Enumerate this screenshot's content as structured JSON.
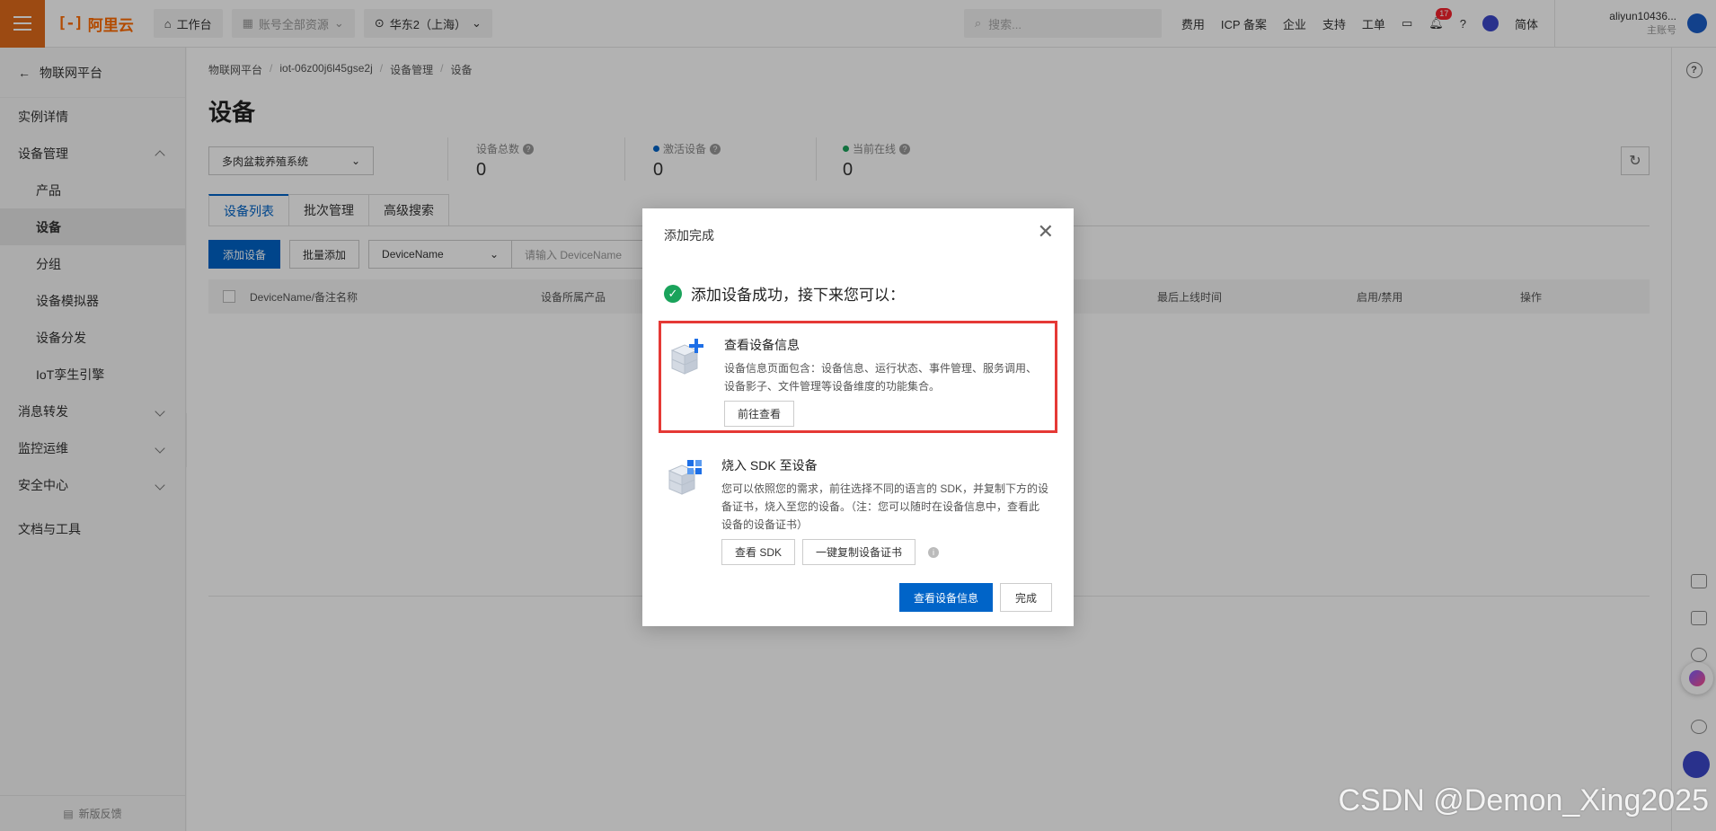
{
  "topbar": {
    "logo_text": "阿里云",
    "logo_mark": "[-]",
    "workbench": "工作台",
    "account_scope": "账号全部资源",
    "region": "华东2（上海）",
    "search_placeholder": "搜索...",
    "links": [
      "费用",
      "ICP 备案",
      "企业",
      "支持",
      "工单"
    ],
    "notification_count": "17",
    "language": "简体",
    "user_name": "aliyun10436...",
    "user_role": "主账号"
  },
  "sidebar": {
    "back_label": "物联网平台",
    "items": [
      {
        "label": "实例详情"
      },
      {
        "label": "设备管理"
      },
      {
        "label": "产品"
      },
      {
        "label": "设备"
      },
      {
        "label": "分组"
      },
      {
        "label": "设备模拟器"
      },
      {
        "label": "设备分发"
      },
      {
        "label": "IoT孪生引擎"
      },
      {
        "label": "消息转发"
      },
      {
        "label": "监控运维"
      },
      {
        "label": "安全中心"
      },
      {
        "label": "文档与工具"
      }
    ],
    "feedback": "新版反馈"
  },
  "main": {
    "breadcrumb": [
      "物联网平台",
      "iot-06z00j6l45gse2j",
      "设备管理",
      "设备"
    ],
    "title": "设备",
    "product_select": "多肉盆栽养殖系统",
    "stats": [
      {
        "label": "设备总数",
        "value": "0",
        "dot_color": ""
      },
      {
        "label": "激活设备",
        "value": "0",
        "dot_color": "#0064c8"
      },
      {
        "label": "当前在线",
        "value": "0",
        "dot_color": "#1aa35b"
      }
    ],
    "tabs": [
      "设备列表",
      "批次管理",
      "高级搜索"
    ],
    "add_device": "添加设备",
    "batch_add": "批量添加",
    "field_select": "DeviceName",
    "search_placeholder": "请输入 DeviceName",
    "columns": [
      "DeviceName/备注名称",
      "设备所属产品",
      "最后上线时间",
      "启用/禁用",
      "操作"
    ]
  },
  "dialog": {
    "title": "添加完成",
    "success_message": "添加设备成功，接下来您可以：",
    "card1": {
      "title": "查看设备信息",
      "desc": "设备信息页面包含：设备信息、运行状态、事件管理、服务调用、设备影子、文件管理等设备维度的功能集合。",
      "button": "前往查看"
    },
    "card2": {
      "title": "烧入 SDK 至设备",
      "desc": "您可以依照您的需求，前往选择不同的语言的 SDK，并复制下方的设备证书，烧入至您的设备。（注：您可以随时在设备信息中，查看此设备的设备证书）",
      "button1": "查看 SDK",
      "button2": "一键复制设备证书"
    },
    "primary_button": "查看设备信息",
    "done_button": "完成"
  },
  "watermark": "CSDN @Demon_Xing2025"
}
